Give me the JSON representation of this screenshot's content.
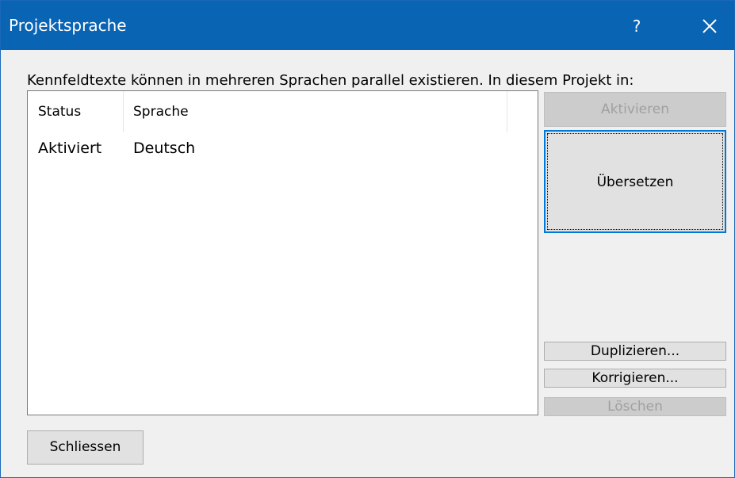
{
  "window": {
    "title": "Projektsprache",
    "help_label": "?",
    "close_icon": "close-icon",
    "titlebar_color": "#0a64b4"
  },
  "intro": "Kennfeldtexte können in mehreren Sprachen parallel existieren. In diesem Projekt in:",
  "languages_list": {
    "columns": [
      "Status",
      "Sprache"
    ],
    "rows": [
      {
        "status": "Aktiviert",
        "sprache": "Deutsch"
      }
    ]
  },
  "buttons": {
    "aktivieren": "Aktivieren",
    "uebersetzen": "Übersetzen",
    "duplizieren": "Duplizieren...",
    "korrigieren": "Korrigieren...",
    "loeschen": "Löschen",
    "schliessen": "Schliessen"
  },
  "colors": {
    "focus_border": "#0078d7",
    "disabled_text": "#a0a0a0"
  }
}
